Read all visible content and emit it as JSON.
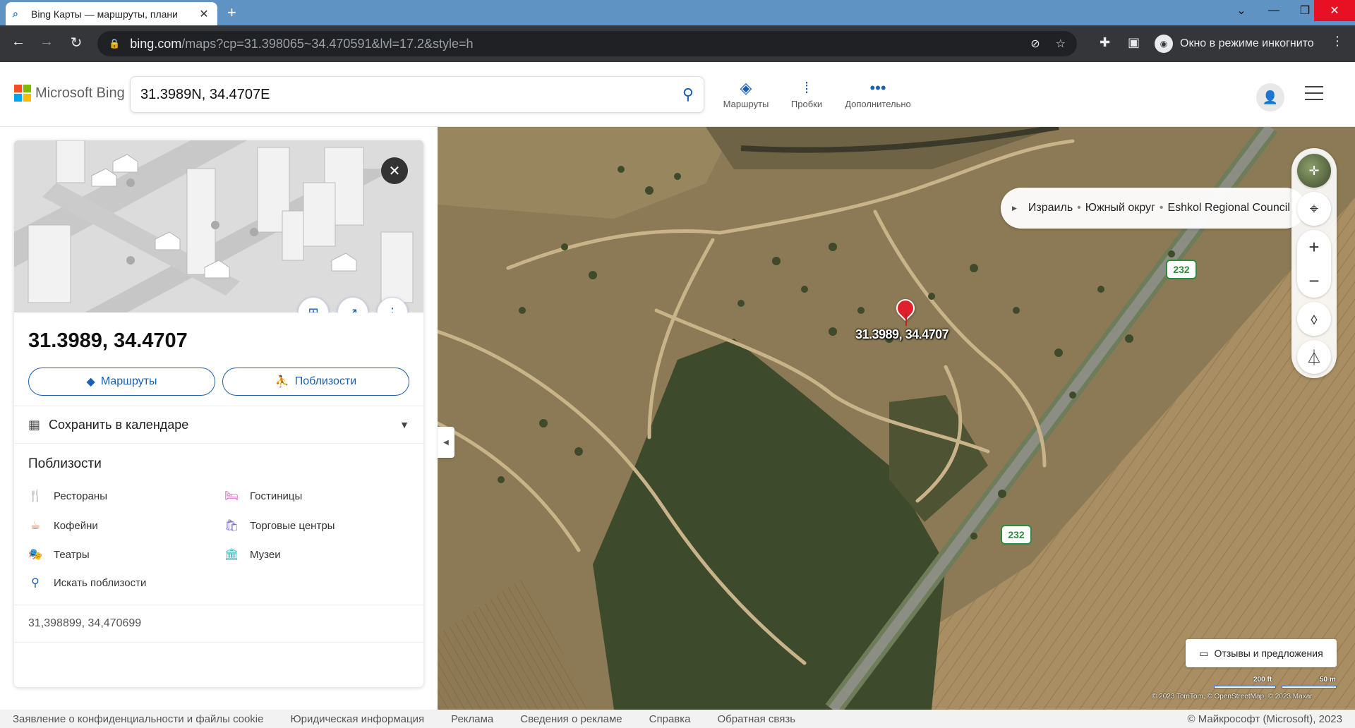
{
  "browser": {
    "tab_title": "Bing Карты — маршруты, плани",
    "url_host": "bing.com",
    "url_path": "/maps?cp=31.398065~34.470591&lvl=17.2&style=h",
    "incognito_label": "Окно в режиме инкогнито"
  },
  "header": {
    "logo_text": "Microsoft Bing",
    "search_value": "31.3989N, 34.4707E",
    "nav": [
      {
        "label": "Маршруты",
        "icon": "directions-icon"
      },
      {
        "label": "Пробки",
        "icon": "traffic-icon"
      },
      {
        "label": "Дополнительно",
        "icon": "more-icon"
      }
    ]
  },
  "panel": {
    "coord_title": "31.3989, 34.4707",
    "routes_button": "Маршруты",
    "nearby_button": "Поблизости",
    "save_calendar": "Сохранить в календаре",
    "nearby_heading": "Поблизости",
    "nearby_items": [
      {
        "label": "Рестораны",
        "icon": "restaurant-icon",
        "color": "#e8743b"
      },
      {
        "label": "Гостиницы",
        "icon": "hotel-icon",
        "color": "#d64fb5"
      },
      {
        "label": "Кофейни",
        "icon": "coffee-icon",
        "color": "#e8743b"
      },
      {
        "label": "Торговые центры",
        "icon": "shopping-icon",
        "color": "#7a6ad8"
      },
      {
        "label": "Театры",
        "icon": "theater-icon",
        "color": "#2bb0b8"
      },
      {
        "label": "Музеи",
        "icon": "museum-icon",
        "color": "#2bb0b8"
      },
      {
        "label": "Искать поблизости",
        "icon": "search-icon",
        "color": "#1a5fb4"
      }
    ],
    "coord_footer": "31,398899, 34,470699"
  },
  "map": {
    "breadcrumb": [
      "Израиль",
      "Южный округ",
      "Eshkol Regional Council"
    ],
    "pin_label": "31.3989, 34.4707",
    "road_shield": "232",
    "feedback_label": "Отзывы и предложения",
    "scale_ft": "200 ft",
    "scale_m": "50 m",
    "attribution": "© 2023 TomTom, © OpenStreetMap, © 2023 Maxar"
  },
  "footer": {
    "links": [
      "Заявление о конфиденциальности и файлы cookie",
      "Юридическая информация",
      "Реклама",
      "Сведения о рекламе",
      "Справка",
      "Обратная связь"
    ],
    "copyright": "© Майкрософт (Microsoft), 2023"
  }
}
